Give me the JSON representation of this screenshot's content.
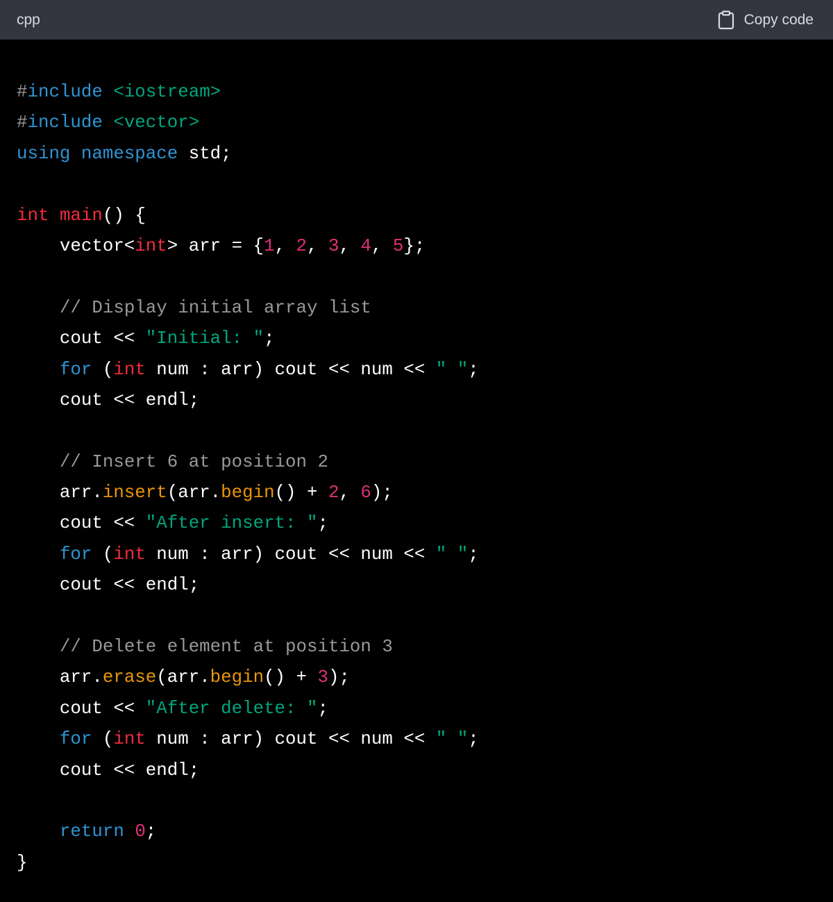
{
  "header": {
    "language": "cpp",
    "copy_label": "Copy code",
    "copy_icon": "clipboard-icon"
  },
  "code_lines": [
    [
      [
        "meta",
        "#"
      ],
      [
        "keyword",
        "include"
      ],
      [
        "plain",
        " "
      ],
      [
        "string",
        "<iostream>"
      ]
    ],
    [
      [
        "meta",
        "#"
      ],
      [
        "keyword",
        "include"
      ],
      [
        "plain",
        " "
      ],
      [
        "string",
        "<vector>"
      ]
    ],
    [
      [
        "keyword",
        "using"
      ],
      [
        "plain",
        " "
      ],
      [
        "keyword",
        "namespace"
      ],
      [
        "plain",
        " std;"
      ]
    ],
    [],
    [
      [
        "type",
        "int"
      ],
      [
        "plain",
        " "
      ],
      [
        "func",
        "main"
      ],
      [
        "plain",
        "() {"
      ]
    ],
    [
      [
        "plain",
        "    vector<"
      ],
      [
        "type",
        "int"
      ],
      [
        "plain",
        "> arr = {"
      ],
      [
        "number",
        "1"
      ],
      [
        "plain",
        ", "
      ],
      [
        "number",
        "2"
      ],
      [
        "plain",
        ", "
      ],
      [
        "number",
        "3"
      ],
      [
        "plain",
        ", "
      ],
      [
        "number",
        "4"
      ],
      [
        "plain",
        ", "
      ],
      [
        "number",
        "5"
      ],
      [
        "plain",
        "};"
      ]
    ],
    [],
    [
      [
        "plain",
        "    "
      ],
      [
        "comment",
        "// Display initial array list"
      ]
    ],
    [
      [
        "plain",
        "    cout << "
      ],
      [
        "string",
        "\"Initial: \""
      ],
      [
        "plain",
        ";"
      ]
    ],
    [
      [
        "plain",
        "    "
      ],
      [
        "keyword",
        "for"
      ],
      [
        "plain",
        " ("
      ],
      [
        "type",
        "int"
      ],
      [
        "plain",
        " num : arr) cout << num << "
      ],
      [
        "string",
        "\" \""
      ],
      [
        "plain",
        ";"
      ]
    ],
    [
      [
        "plain",
        "    cout << endl;"
      ]
    ],
    [],
    [
      [
        "plain",
        "    "
      ],
      [
        "comment",
        "// Insert 6 at position 2"
      ]
    ],
    [
      [
        "plain",
        "    arr."
      ],
      [
        "method",
        "insert"
      ],
      [
        "plain",
        "(arr."
      ],
      [
        "method",
        "begin"
      ],
      [
        "plain",
        "() + "
      ],
      [
        "number",
        "2"
      ],
      [
        "plain",
        ", "
      ],
      [
        "number",
        "6"
      ],
      [
        "plain",
        ");"
      ]
    ],
    [
      [
        "plain",
        "    cout << "
      ],
      [
        "string",
        "\"After insert: \""
      ],
      [
        "plain",
        ";"
      ]
    ],
    [
      [
        "plain",
        "    "
      ],
      [
        "keyword",
        "for"
      ],
      [
        "plain",
        " ("
      ],
      [
        "type",
        "int"
      ],
      [
        "plain",
        " num : arr) cout << num << "
      ],
      [
        "string",
        "\" \""
      ],
      [
        "plain",
        ";"
      ]
    ],
    [
      [
        "plain",
        "    cout << endl;"
      ]
    ],
    [],
    [
      [
        "plain",
        "    "
      ],
      [
        "comment",
        "// Delete element at position 3"
      ]
    ],
    [
      [
        "plain",
        "    arr."
      ],
      [
        "method",
        "erase"
      ],
      [
        "plain",
        "(arr."
      ],
      [
        "method",
        "begin"
      ],
      [
        "plain",
        "() + "
      ],
      [
        "number",
        "3"
      ],
      [
        "plain",
        ");"
      ]
    ],
    [
      [
        "plain",
        "    cout << "
      ],
      [
        "string",
        "\"After delete: \""
      ],
      [
        "plain",
        ";"
      ]
    ],
    [
      [
        "plain",
        "    "
      ],
      [
        "keyword",
        "for"
      ],
      [
        "plain",
        " ("
      ],
      [
        "type",
        "int"
      ],
      [
        "plain",
        " num : arr) cout << num << "
      ],
      [
        "string",
        "\" \""
      ],
      [
        "plain",
        ";"
      ]
    ],
    [
      [
        "plain",
        "    cout << endl;"
      ]
    ],
    [],
    [
      [
        "plain",
        "    "
      ],
      [
        "keyword",
        "return"
      ],
      [
        "plain",
        " "
      ],
      [
        "number",
        "0"
      ],
      [
        "plain",
        ";"
      ]
    ],
    [
      [
        "plain",
        "}"
      ]
    ]
  ]
}
